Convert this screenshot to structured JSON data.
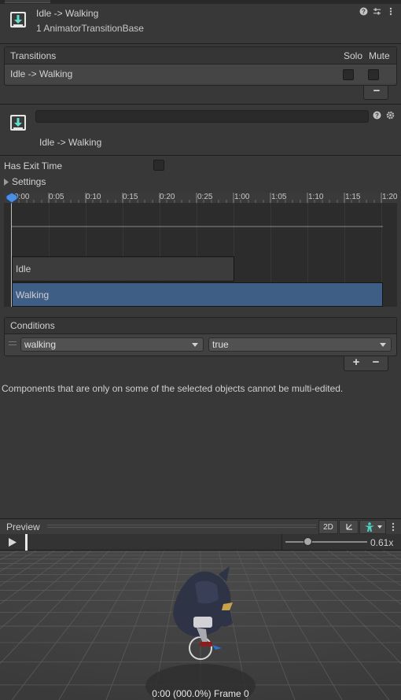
{
  "header": {
    "title": "Idle -> Walking",
    "subtitle": "1 AnimatorTransitionBase",
    "icons": [
      "help-icon",
      "preset-icon",
      "more-icon"
    ]
  },
  "transitions": {
    "header_label": "Transitions",
    "solo_label": "Solo",
    "mute_label": "Mute",
    "rows": [
      {
        "label": "Idle -> Walking",
        "solo": false,
        "mute": false
      }
    ],
    "remove_label": "−"
  },
  "transition_detail": {
    "name_value": "",
    "caption": "Idle -> Walking"
  },
  "settings": {
    "has_exit_time_label": "Has Exit Time",
    "has_exit_time": false,
    "settings_label": "Settings"
  },
  "timeline": {
    "ruler_labels": [
      "0:00",
      "0:05",
      "0:10",
      "0:15",
      "0:20",
      "0:25",
      "1:00",
      "1:05",
      "1:10",
      "1:15",
      "1:20"
    ],
    "source_state": "Idle",
    "destination_state": "Walking"
  },
  "conditions": {
    "header_label": "Conditions",
    "items": [
      {
        "parameter": "walking",
        "value": "true"
      }
    ],
    "add_label": "+",
    "remove_label": "−"
  },
  "info_message": "Components that are only on some of the selected objects cannot be multi-edited.",
  "preview": {
    "label": "Preview",
    "mode_2d_label": "2D",
    "speed": "0.61x",
    "speed_fraction": 0.28,
    "status": "0:00 (000.0%) Frame 0"
  },
  "colors": {
    "accent_blue": "#3e5e85",
    "panel_bg": "#383838",
    "avatar_icon": "#4cd3c2"
  }
}
